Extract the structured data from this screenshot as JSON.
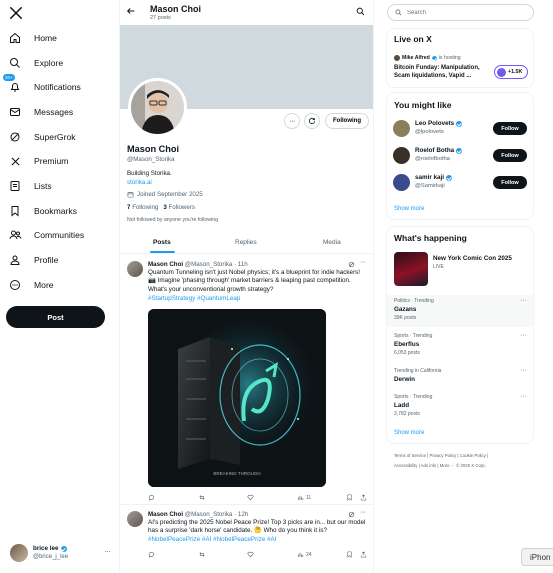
{
  "nav": {
    "items": [
      {
        "label": "Home",
        "icon": "home-icon"
      },
      {
        "label": "Explore",
        "icon": "search-icon"
      },
      {
        "label": "Notifications",
        "icon": "bell-icon",
        "badge": "20+"
      },
      {
        "label": "Messages",
        "icon": "mail-icon"
      },
      {
        "label": "SuperGrok",
        "icon": "grok-icon"
      },
      {
        "label": "Premium",
        "icon": "x-logo-icon"
      },
      {
        "label": "Lists",
        "icon": "list-icon"
      },
      {
        "label": "Bookmarks",
        "icon": "bookmark-icon"
      },
      {
        "label": "Communities",
        "icon": "people-icon"
      },
      {
        "label": "Profile",
        "icon": "person-icon"
      },
      {
        "label": "More",
        "icon": "more-circle-icon"
      }
    ],
    "post_label": "Post"
  },
  "account": {
    "name": "brice lee",
    "handle": "@brice_j_lee"
  },
  "header": {
    "name": "Mason Choi",
    "posts": "27 posts"
  },
  "profile": {
    "name": "Mason Choi",
    "handle": "@Mason_Storika",
    "bio": "Building Storika.",
    "link": "storika.ai",
    "joined": "Joined September 2025",
    "following_count": "7",
    "following_label": "Following",
    "followers_count": "3",
    "followers_label": "Followers",
    "followed_note": "Not followed by anyone you're following",
    "follow_button": "Following"
  },
  "tabs": [
    "Posts",
    "Replies",
    "Media"
  ],
  "tweets": [
    {
      "name": "Mason Choi",
      "handle": "@Mason_Storika",
      "time": "· 11h",
      "text": "Quantum Tunneling isn't just Nobel physics; it's a blueprint for indie hackers! 📷 Imagine 'phasing through' market barriers & leaping past competition. What's your unconventional growth strategy?",
      "hashtags": "#StartupStrategy #QuantumLeap",
      "image_caption": "BREAKING THROUGH",
      "views": "11"
    },
    {
      "name": "Mason Choi",
      "handle": "@Mason_Storika",
      "time": "· 12h",
      "text": "AI's predicting the 2025 Nobel Peace Prize! Top 3 picks are in... but our model has a surprise 'dark horse' candidate. 🤔 Who do you think it is?",
      "hashtags": "#NobelPeacePrize #AI #NobelPeacePrize #AI",
      "views": "24"
    }
  ],
  "search": {
    "placeholder": "Search"
  },
  "live": {
    "title": "Live on X",
    "host": "Mike Alfred",
    "hosting": "is hosting",
    "headline": "Bitcoin Funday: Manipulation, Scam liquidations, Vapid ...",
    "count": "+1.5K"
  },
  "who_to_follow": {
    "title": "You might like",
    "people": [
      {
        "name": "Leo Polovets",
        "handle": "@lpolovets",
        "button": "Follow",
        "color": "#8a7f5a"
      },
      {
        "name": "Roelof Botha",
        "handle": "@roelofbotha",
        "button": "Follow",
        "color": "#3a3028"
      },
      {
        "name": "samir kaji",
        "handle": "@Samirkaji",
        "button": "Follow",
        "color": "#3b4a8c"
      }
    ],
    "show_more": "Show more"
  },
  "happening": {
    "title": "What's happening",
    "event": {
      "title": "New York Comic Con 2025",
      "status": "LIVE"
    },
    "trends": [
      {
        "context": "Politics · Trending",
        "topic": "Gazans",
        "count": "39K posts"
      },
      {
        "context": "Sports · Trending",
        "topic": "Eberflus",
        "count": "6,053 posts"
      },
      {
        "context": "Trending in California",
        "topic": "Derwin",
        "count": ""
      },
      {
        "context": "Sports · Trending",
        "topic": "Ladd",
        "count": "3,782 posts"
      }
    ],
    "show_more": "Show more"
  },
  "footer": {
    "line1": "Terms of Service  |  Privacy Policy  |  Cookie Policy  |",
    "line2": "Accessibility  |  Ads info  |  More ···  © 2025 X Corp."
  },
  "overlay_tag": "iPhon",
  "colors": {
    "accent": "#1d9bf0",
    "dark": "#0f1419",
    "muted": "#536471",
    "banner": "#cfd9de"
  }
}
